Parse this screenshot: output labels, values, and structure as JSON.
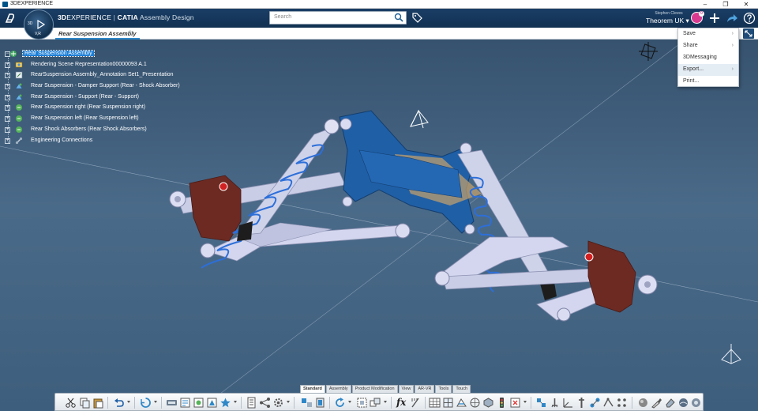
{
  "os_window": {
    "title": "3DEXPERIENCE",
    "controls": [
      "–",
      "❐",
      "✕"
    ]
  },
  "header": {
    "brand_3d": "3D",
    "brand_experience": "EXPERIENCE",
    "brand_separator": " | ",
    "brand_catia": "CATIA",
    "app_name": " Assembly Design",
    "compass_labels": {
      "left": "3D",
      "bottom": "V,R"
    },
    "search_placeholder": "Search",
    "user_name": "Stephen Cleves",
    "tenant": "Theorem UK ▾",
    "avatar_badge": "0"
  },
  "tabs": {
    "active_tab": "Rear Suspension Assembly",
    "add_tab": "+"
  },
  "share_menu": {
    "items": [
      {
        "label": "Save",
        "chevron": "›"
      },
      {
        "label": "Share",
        "chevron": "›"
      },
      {
        "label": "3DMessaging",
        "chevron": ""
      },
      {
        "label": "Export...",
        "chevron": "›"
      },
      {
        "label": "Print...",
        "chevron": ""
      }
    ]
  },
  "tree": {
    "root": "Rear Suspension Assembly",
    "items": [
      {
        "label": "Rendering Scene Representation00000093 A.1",
        "icon": "scene-icon"
      },
      {
        "label": "RearSuspension Assembly_Annotation Set1_Presentation",
        "icon": "annotation-icon"
      },
      {
        "label": "Rear Suspension - Damper Support (Rear - Shock Absorber)",
        "icon": "part-icon"
      },
      {
        "label": "Rear Suspension - Support (Rear - Support)",
        "icon": "part-icon"
      },
      {
        "label": "Rear Suspension right (Rear Suspension right)",
        "icon": "product-icon"
      },
      {
        "label": "Rear Suspension left (Rear Suspension left)",
        "icon": "product-icon"
      },
      {
        "label": "Rear Shock Absorbers (Rear Shock Absorbers)",
        "icon": "product-icon"
      },
      {
        "label": "Engineering Connections",
        "icon": "connections-icon"
      }
    ],
    "expander": "+"
  },
  "action_bar": {
    "section_tabs": [
      "Standard",
      "Assembly",
      "Product Modification",
      "View",
      "AR-VR",
      "Tools",
      "Touch"
    ],
    "active_section": "Standard",
    "formula_glyph": "fx"
  },
  "colors": {
    "top_bar": "#1a3e66",
    "viewport": "#4a6a89",
    "selection": "#1e7fd6",
    "spring": "#2d6fd9",
    "bracket": "#1f5fa6",
    "knuckle": "#6d2a22",
    "arm": "#cfd3ea"
  }
}
